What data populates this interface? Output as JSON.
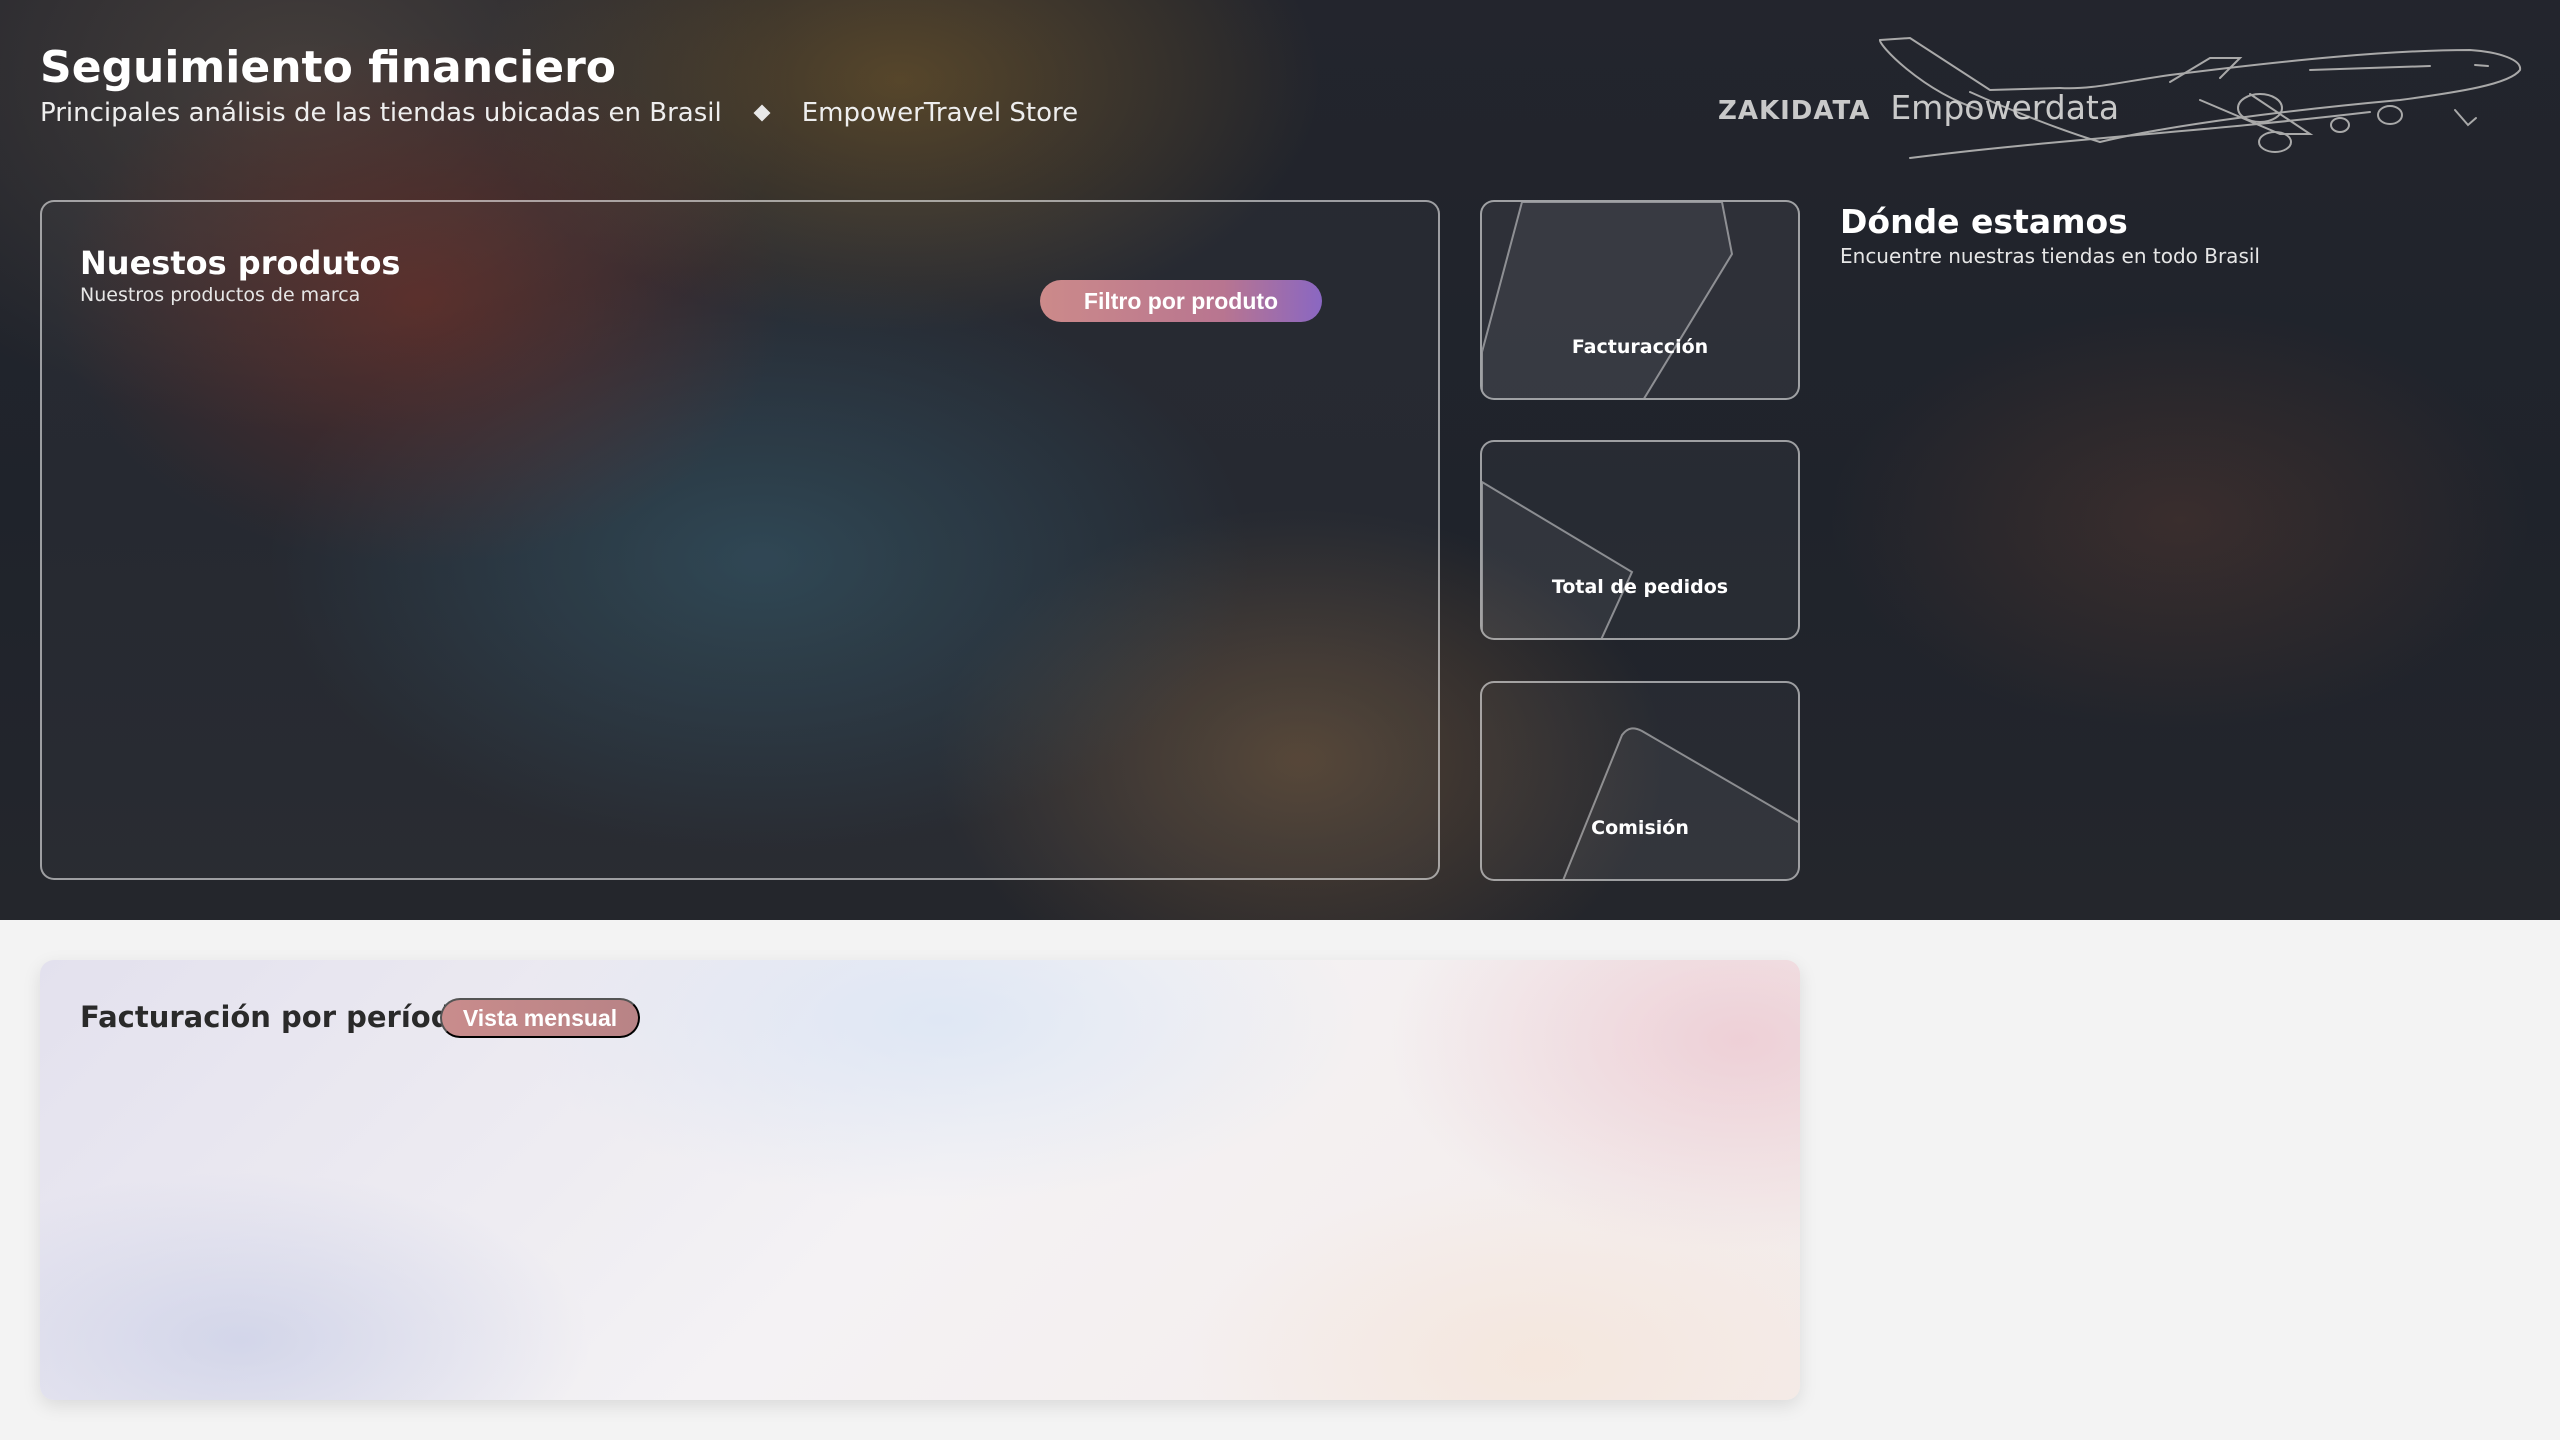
{
  "header": {
    "title": "Seguimiento financiero",
    "subtitle": "Principales análisis de las tiendas ubicadas en Brasil",
    "store": "EmpowerTravel Store"
  },
  "brand": {
    "company": "ZAKIDATA",
    "product": "Empowerdata"
  },
  "products": {
    "title": "Nuestos produtos",
    "subtitle": "Nuestros productos de marca",
    "filter_label": "Filtro por produto"
  },
  "kpis": [
    {
      "label": "Facturacción"
    },
    {
      "label": "Total de pedidos"
    },
    {
      "label": "Comisión"
    }
  ],
  "locations": {
    "title": "Dónde estamos",
    "subtitle": "Encuentre nuestras tiendas en todo Brasil"
  },
  "period": {
    "title": "Facturación por período",
    "view_label": "Vista mensual"
  },
  "colors": {
    "accent_pink": "#cc8a8a",
    "accent_purple": "#8a67c2",
    "hero_bg": "#23252d",
    "page_bg": "#f3f3f3"
  }
}
